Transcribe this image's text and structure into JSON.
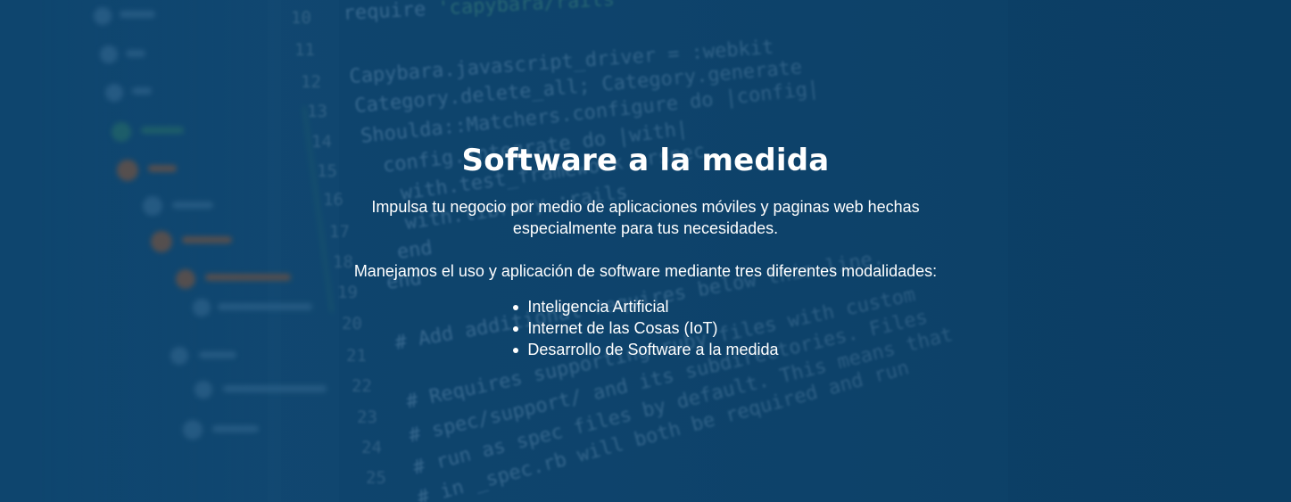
{
  "hero": {
    "title": "Software a la medida",
    "paragraph_1_line_1": "Impulsa tu negocio por medio de aplicaciones móviles y paginas web hechas",
    "paragraph_1_line_2": "especialmente para tus necesidades.",
    "paragraph_2": "Manejamos el uso y aplicación de software mediante tres diferentes modalidades:",
    "items": [
      {
        "label": "Inteligencia Artificial"
      },
      {
        "label": "Internet de las Cosas (IoT)"
      },
      {
        "label": "Desarrollo de Software a la medida"
      }
    ]
  },
  "background": {
    "colors": {
      "base": "#0f4670",
      "overlay": "#0a3b5f",
      "code_text": "#8db6d8",
      "line_numbers": "#6f95b3",
      "highlight": "#2d7a68",
      "orange_icon": "#a45b2f"
    }
  }
}
